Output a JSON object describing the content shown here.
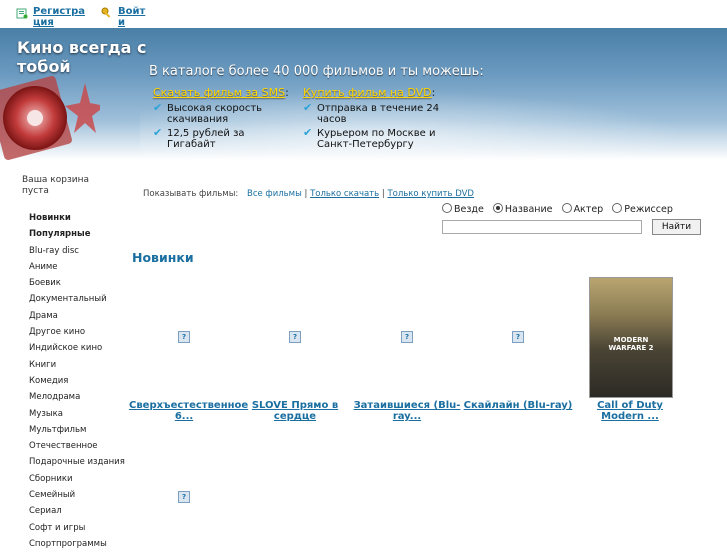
{
  "topbar": {
    "register": "Регистрация",
    "login": "Войти"
  },
  "header": {
    "site_title": "Кино всегда с тобой",
    "catalog_text": "В каталоге более 40 000 фильмов и ты можешь:",
    "sms": {
      "link": "Скачать фильм за SMS",
      "tail": ":",
      "features": [
        "Высокая скорость скачивания",
        "12,5 рублей за Гигабайт"
      ]
    },
    "dvd": {
      "link": "Купить фильм на DVD",
      "tail": ":",
      "features": [
        "Отправка в течение 24 часов",
        "Курьером по Москве и Санкт-Петербургу"
      ]
    }
  },
  "cart": {
    "text": "Ваша корзина пуста"
  },
  "nav": {
    "items": [
      "Новинки",
      "Популярные",
      "Blu-ray disc",
      "Аниме",
      "Боевик",
      "Документальный",
      "Драма",
      "Другое кино",
      "Индийское кино",
      "Книги",
      "Комедия",
      "Мелодрама",
      "Музыка",
      "Мультфильм",
      "Отечественное",
      "Подарочные издания",
      "Сборники",
      "Семейный",
      "Сериал",
      "Софт и игры",
      "Спортпрограммы"
    ]
  },
  "filter": {
    "label": "Показывать фильмы:",
    "all": "Все фильмы",
    "sep": "|",
    "download": "Только скачать",
    "buy": "Только купить DVD"
  },
  "search": {
    "options": [
      "Везде",
      "Название",
      "Актер",
      "Режиссер"
    ],
    "selected": "Название",
    "value": "",
    "button": "Найти"
  },
  "section": {
    "title": "Новинки"
  },
  "products": [
    {
      "title": "Сверхъестественное 6..."
    },
    {
      "title": "SLOVE Прямо в сердце"
    },
    {
      "title": "Затаившиеся (Blu-ray..."
    },
    {
      "title": "Скайлайн (Blu-ray)"
    },
    {
      "title": "Call of Duty Modern ..."
    }
  ],
  "cover_text": "MODERN WARFARE 2",
  "placeholder_glyph": "?",
  "check_glyph": "✔"
}
